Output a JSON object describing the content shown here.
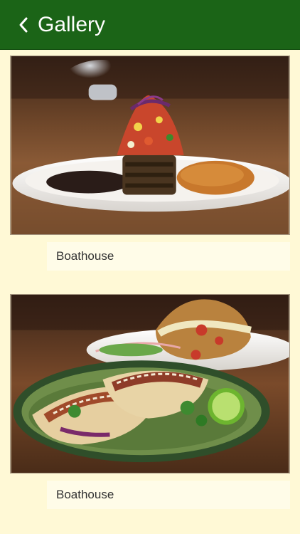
{
  "header": {
    "title": "Gallery",
    "back_icon": "chevron-left-icon",
    "background_color": "#1b6417"
  },
  "gallery": {
    "items": [
      {
        "image": "grilled-fish-plate-photo",
        "caption": "Boathouse"
      },
      {
        "image": "tacos-and-burger-photo",
        "caption": "Boathouse"
      }
    ]
  }
}
